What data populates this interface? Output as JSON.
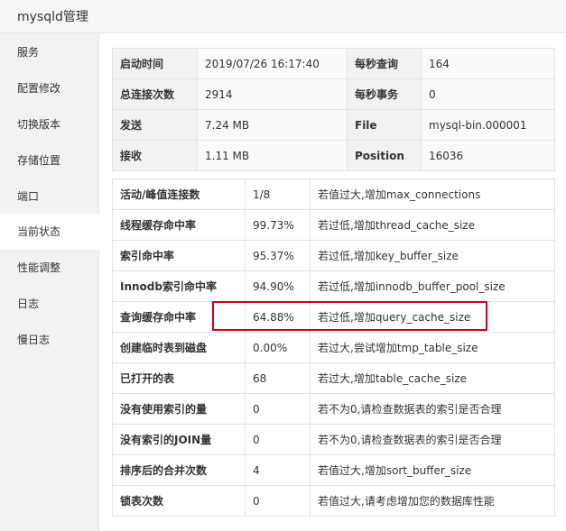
{
  "window": {
    "title": "mysqld管理"
  },
  "sidebar": {
    "items": [
      {
        "label": "服务"
      },
      {
        "label": "配置修改"
      },
      {
        "label": "切换版本"
      },
      {
        "label": "存储位置"
      },
      {
        "label": "端口"
      },
      {
        "label": "当前状态"
      },
      {
        "label": "性能调整"
      },
      {
        "label": "日志"
      },
      {
        "label": "慢日志"
      }
    ],
    "active": "当前状态"
  },
  "summary": {
    "rows": [
      {
        "l1": "启动时间",
        "v1": "2019/07/26 16:17:40",
        "l2": "每秒查询",
        "v2": "164"
      },
      {
        "l1": "总连接次数",
        "v1": "2914",
        "l2": "每秒事务",
        "v2": "0"
      },
      {
        "l1": "发送",
        "v1": "7.24 MB",
        "l2": "File",
        "v2": "mysql-bin.000001"
      },
      {
        "l1": "接收",
        "v1": "1.11 MB",
        "l2": "Position",
        "v2": "16036"
      }
    ]
  },
  "metrics": {
    "rows": [
      {
        "name": "活动/峰值连接数",
        "value": "1/8",
        "advice": "若值过大,增加max_connections"
      },
      {
        "name": "线程缓存命中率",
        "value": "99.73%",
        "advice": "若过低,增加thread_cache_size"
      },
      {
        "name": "索引命中率",
        "value": "95.37%",
        "advice": "若过低,增加key_buffer_size"
      },
      {
        "name": "Innodb索引命中率",
        "value": "94.90%",
        "advice": "若过低,增加innodb_buffer_pool_size"
      },
      {
        "name": "查询缓存命中率",
        "value": "64.88%",
        "advice": "若过低,增加query_cache_size"
      },
      {
        "name": "创建临时表到磁盘",
        "value": "0.00%",
        "advice": "若过大,尝试增加tmp_table_size"
      },
      {
        "name": "已打开的表",
        "value": "68",
        "advice": "若过大,增加table_cache_size"
      },
      {
        "name": "没有使用索引的量",
        "value": "0",
        "advice": "若不为0,请检查数据表的索引是否合理"
      },
      {
        "name": "没有索引的JOIN量",
        "value": "0",
        "advice": "若不为0,请检查数据表的索引是否合理"
      },
      {
        "name": "排序后的合并次数",
        "value": "4",
        "advice": "若值过大,增加sort_buffer_size"
      },
      {
        "name": "锁表次数",
        "value": "0",
        "advice": "若值过大,请考虑增加您的数据库性能"
      }
    ],
    "highlight_color": "#d0021b"
  }
}
